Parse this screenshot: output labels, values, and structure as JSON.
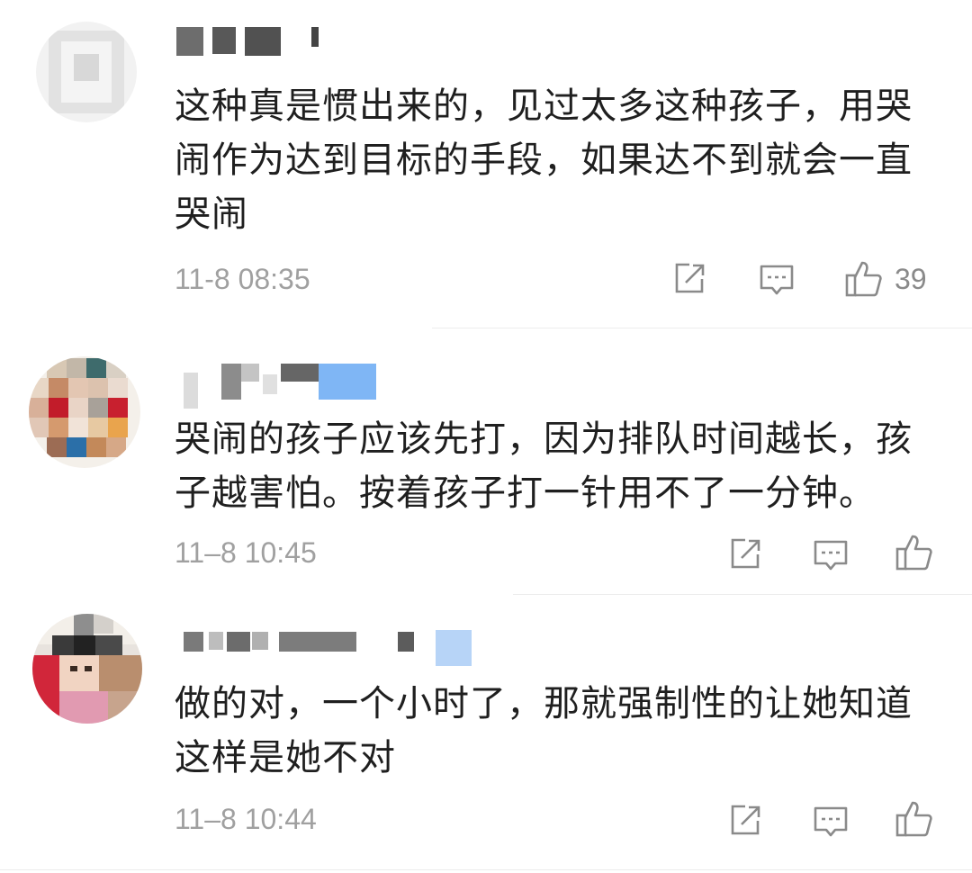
{
  "comments": [
    {
      "text": "这种真是惯出来的，见过太多这种孩子，用哭闹作为达到目标的手段，如果达不到就会一直哭闹",
      "time": "11-8 08:35",
      "like_count": "39"
    },
    {
      "text": "哭闹的孩子应该先打，因为排队时间越长，孩子越害怕。按着孩子打一针用不了一分钟。",
      "time": "11–8 10:45",
      "like_count": ""
    },
    {
      "text": "做的对，一个小时了，那就强制性的让她知道这样是她不对",
      "time": "11–8 10:44",
      "like_count": ""
    }
  ],
  "icons": {
    "share": "share-icon",
    "reply": "reply-icon",
    "like": "thumbs-up-icon"
  },
  "colors": {
    "text": "#1f1f1f",
    "meta": "#a0a0a0",
    "icon": "#8a8a8a",
    "divider": "#ececec",
    "verified_badge": "#7fb6f5"
  }
}
